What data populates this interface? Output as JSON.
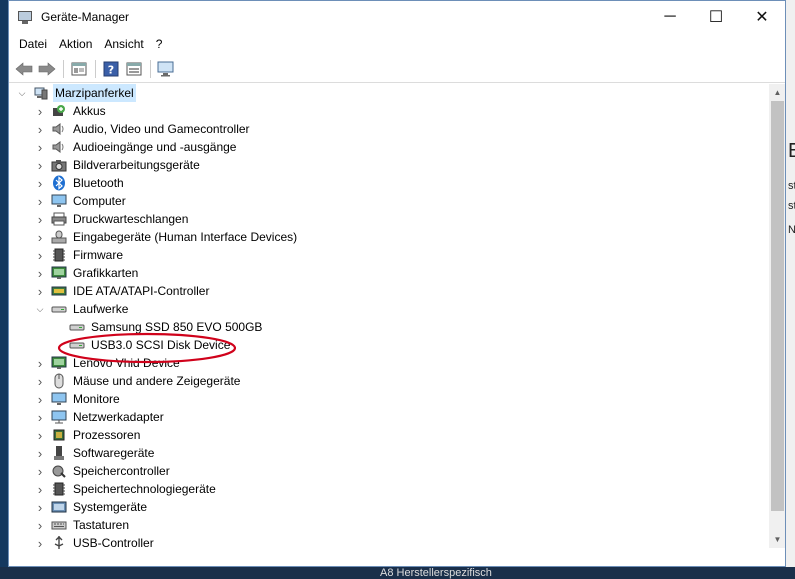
{
  "window": {
    "title": "Geräte-Manager",
    "controls": {
      "minimize": "─",
      "maximize": "☐",
      "close": "✕"
    }
  },
  "menu": [
    "Datei",
    "Aktion",
    "Ansicht",
    "?"
  ],
  "toolbar": {
    "buttons": [
      "back-arrow-icon",
      "forward-arrow-icon",
      "properties-icon",
      "help-icon",
      "device-view-icon",
      "monitor-scan-icon"
    ]
  },
  "tree": {
    "root": "Marzipanferkel",
    "categories": [
      "Akkus",
      "Audio, Video und Gamecontroller",
      "Audioeingänge und -ausgänge",
      "Bildverarbeitungsgeräte",
      "Bluetooth",
      "Computer",
      "Druckwarteschlangen",
      "Eingabegeräte (Human Interface Devices)",
      "Firmware",
      "Grafikkarten",
      "IDE ATA/ATAPI-Controller",
      "Laufwerke"
    ],
    "drives": [
      "Samsung SSD 850 EVO 500GB",
      "USB3.0  SCSI Disk Device"
    ],
    "categories_after": [
      "Lenovo Vhid Device",
      "Mäuse und andere Zeigegeräte",
      "Monitore",
      "Netzwerkadapter",
      "Prozessoren",
      "Softwaregeräte",
      "Speichercontroller",
      "Speichertechnologiegeräte",
      "Systemgeräte",
      "Tastaturen",
      "USB-Controller"
    ]
  },
  "background": {
    "right_texts": [
      "E",
      "st",
      "st",
      "N"
    ],
    "bottom_text": "A8     Herstellerspezifisch"
  },
  "annotation_color": "#d0021b"
}
